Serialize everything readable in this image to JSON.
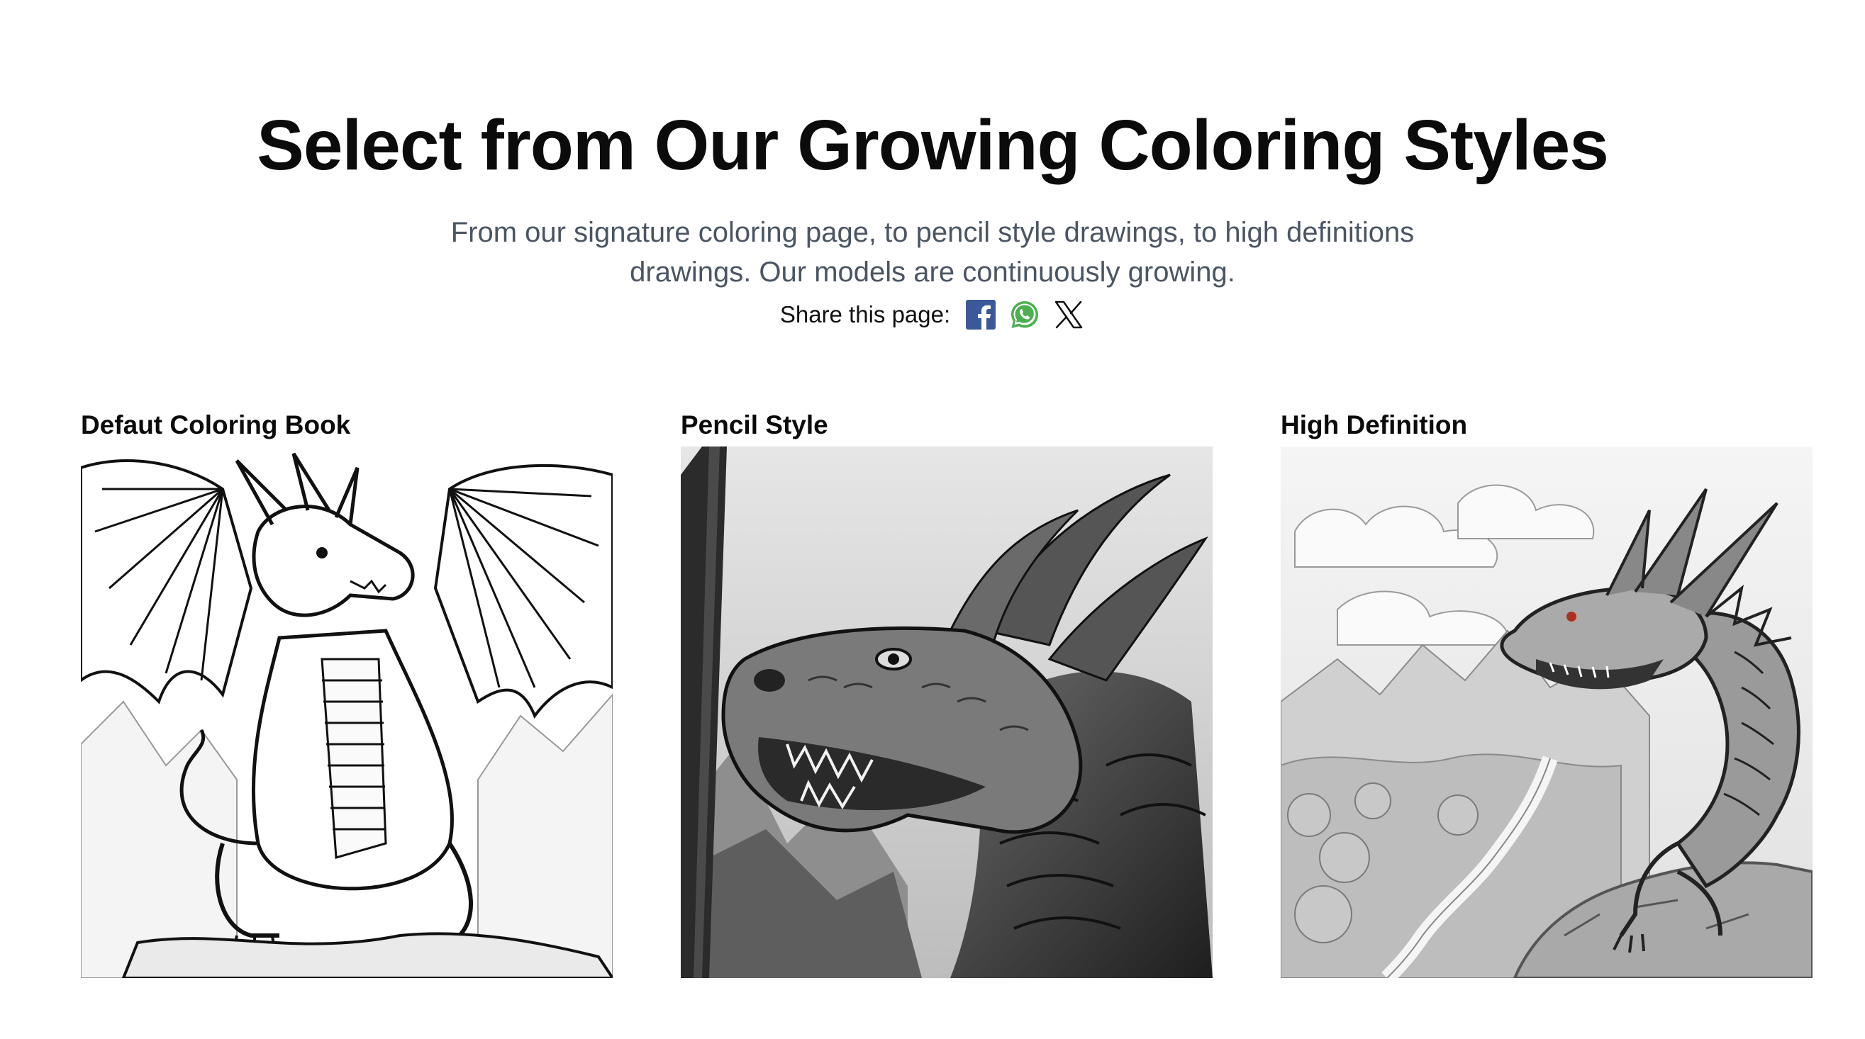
{
  "hero": {
    "title": "Select from Our Growing Coloring Styles",
    "subtitle": "From our signature coloring page, to pencil style drawings, to high definitions drawings. Our models are continuously growing."
  },
  "share": {
    "label": "Share this page:",
    "buttons": [
      {
        "icon": "facebook-icon",
        "color": "#3b5998"
      },
      {
        "icon": "whatsapp-icon",
        "color": "#4caf50"
      },
      {
        "icon": "x-icon",
        "color": "#111111"
      }
    ]
  },
  "styles": [
    {
      "label": "Defaut Coloring Book",
      "image": "line-art dragon with spread wings on rock"
    },
    {
      "label": "Pencil Style",
      "image": "pencil sketch of dragon head with pencil on left"
    },
    {
      "label": "High Definition",
      "image": "detailed dragon on cliff over river valley"
    }
  ]
}
